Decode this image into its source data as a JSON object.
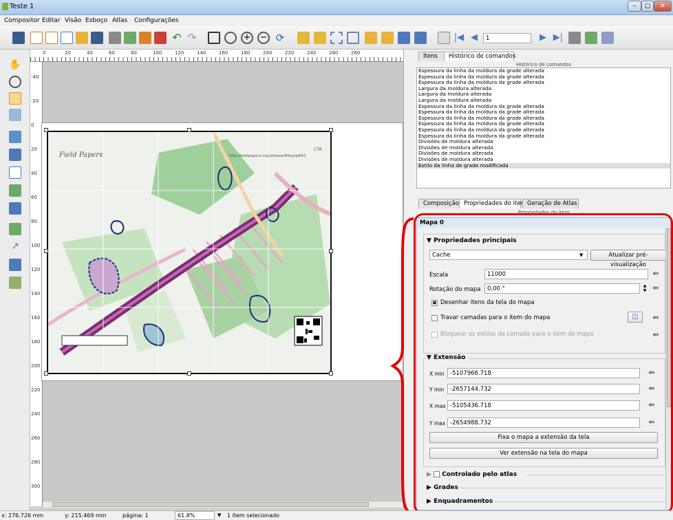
{
  "window": {
    "title": "Teste 1",
    "controls": [
      "–",
      "▢",
      "✕"
    ]
  },
  "menubar": {
    "items": [
      "Compositor",
      "Editar",
      "Visão",
      "Esboço",
      "Atlas",
      "Configurações"
    ]
  },
  "toolbar": {
    "atlas_page": "1"
  },
  "ruler": {
    "h_ticks": [
      "0",
      "20",
      "40",
      "60",
      "80",
      "100",
      "120",
      "140",
      "160",
      "180",
      "200",
      "220",
      "240",
      "260",
      "280"
    ],
    "v_ticks": [
      "-40",
      "-20",
      "0",
      "20",
      "40",
      "60",
      "80",
      "100",
      "120",
      "140",
      "160",
      "180",
      "200",
      "220",
      "240",
      "260",
      "280",
      "300"
    ]
  },
  "map": {
    "title": "Field Papers",
    "corner_label": "CTA",
    "url": "http://fieldpapers.org/atlases/8lksylp#A1"
  },
  "upper_tabs": {
    "items": "Itens",
    "history": "Histórico de comandos"
  },
  "history": {
    "header": "Histórico de comandos",
    "entries": [
      "Espessura da linha da moldura da grade alterada",
      "Espessura da linha da moldura da grade alterada",
      "Espessura da linha da moldura da grade alterada",
      "Largura da moldura alterada",
      "Largura da moldura alterada",
      "Largura da moldura alterada",
      "Espessura da linha da moldura da grade alterada",
      "Espessura da linha da moldura da grade alterada",
      "Espessura da linha da moldura da grade alterada",
      "Espessura da linha da moldura da grade alterada",
      "Espessura da linha da moldura da grade alterada",
      "Espessura da linha da moldura da grade alterada",
      "Divisões de moldura alterada",
      "Divisões de moldura alterada",
      "Divisões de moldura alterada",
      "Divisões de moldura alterada",
      "Estilo da linha de grade modificada"
    ]
  },
  "lower_tabs": {
    "composition": "Composição",
    "item_props": "Propriedades do item",
    "atlas_gen": "Geração de Atlas"
  },
  "item_props": {
    "header": "Propriedades do item",
    "item_name": "Mapa 0",
    "main_group": "Propriedades principais",
    "cache_value": "Cache",
    "update_preview": "Atualizar pré-visualização",
    "scale_label": "Escala",
    "scale_value": "11000",
    "rotation_label": "Rotação do mapa",
    "rotation_value": "0,00 °",
    "draw_canvas_items": "Desenhar itens da tela do mapa",
    "lock_layers": "Travar camadas para o item do mapa",
    "lock_styles": "Bloquear os estilos da camada para o item de mapa",
    "extent_group": "Extensão",
    "xmin_label": "X min",
    "xmin_value": "-5107966.718",
    "ymin_label": "Y min",
    "ymin_value": "-2657144.732",
    "xmax_label": "X max",
    "xmax_value": "-5105436.718",
    "ymax_label": "Y max",
    "ymax_value": "-2654988.732",
    "set_extent": "Fixa o mapa a extensão da tela",
    "view_extent": "Ver extensão na tela do mapa",
    "atlas_controlled": "Controlado pelo atlas",
    "grids": "Grades",
    "frames": "Enquadramentos"
  },
  "status": {
    "x": "x: 276.726 mm",
    "y": "y: 215.469 mm",
    "page": "página: 1",
    "zoom": "61.8%",
    "selection": "1 item selecionado"
  },
  "colors": {
    "highlight": "#e40000",
    "map_green": "#9fcf9a",
    "road_purple": "#7b2c72"
  }
}
